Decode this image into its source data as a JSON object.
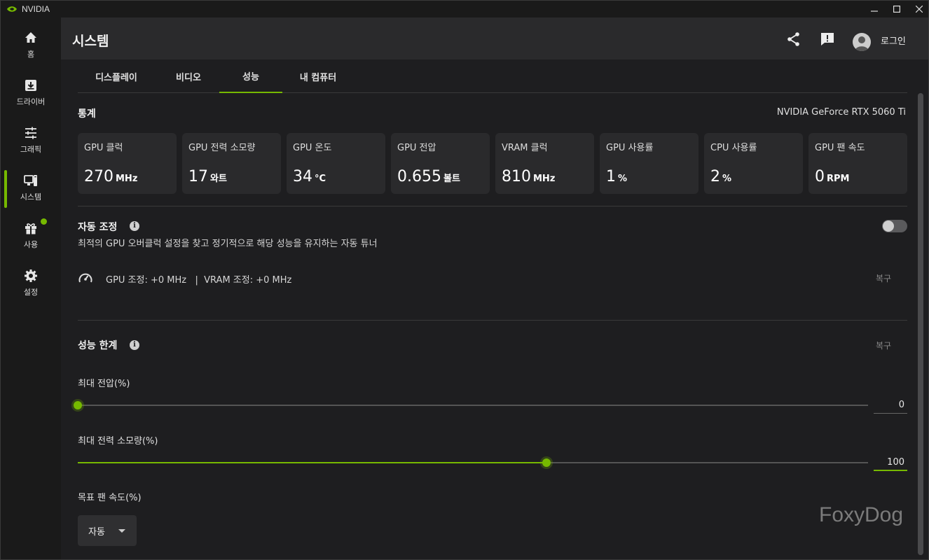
{
  "window": {
    "app_name": "NVIDIA"
  },
  "sidebar": {
    "items": [
      {
        "label": "홈",
        "icon": "home-icon"
      },
      {
        "label": "드라이버",
        "icon": "download-icon"
      },
      {
        "label": "그래픽",
        "icon": "sliders-icon"
      },
      {
        "label": "시스템",
        "icon": "system-icon",
        "active": true
      },
      {
        "label": "사용",
        "icon": "gift-icon",
        "notification": true
      },
      {
        "label": "설정",
        "icon": "gear-icon"
      }
    ]
  },
  "header": {
    "title": "시스템",
    "login_label": "로그인"
  },
  "tabs": [
    {
      "label": "디스플레이"
    },
    {
      "label": "비디오"
    },
    {
      "label": "성능",
      "active": true
    },
    {
      "label": "내 컴퓨터"
    }
  ],
  "stats": {
    "title": "통계",
    "gpu_name": "NVIDIA GeForce RTX 5060 Ti",
    "cards": [
      {
        "label": "GPU 클럭",
        "value": "270",
        "unit": "MHz"
      },
      {
        "label": "GPU 전력 소모량",
        "value": "17",
        "unit": "와트"
      },
      {
        "label": "GPU 온도",
        "value": "34",
        "unit": "°C"
      },
      {
        "label": "GPU 전압",
        "value": "0.655",
        "unit": "볼트"
      },
      {
        "label": "VRAM 클럭",
        "value": "810",
        "unit": "MHz"
      },
      {
        "label": "GPU 사용률",
        "value": "1",
        "unit": "%"
      },
      {
        "label": "CPU 사용률",
        "value": "2",
        "unit": "%"
      },
      {
        "label": "GPU 팬 속도",
        "value": "0",
        "unit": "RPM"
      }
    ]
  },
  "auto_tune": {
    "title": "자동 조정",
    "description": "최적의 GPU 오버클럭 설정을 찾고 정기적으로 해당 성능을 유지하는 자동 튜너",
    "toggle_on": false,
    "adjustment_text": "GPU 조정: +0 MHz   |  VRAM 조정: +0 MHz",
    "reset_label": "복구"
  },
  "performance_limits": {
    "title": "성능 한계",
    "reset_label": "복구",
    "sliders": [
      {
        "label": "최대 전압(%)",
        "value": "0",
        "fraction": 0.0
      },
      {
        "label": "최대 전력 소모량(%)",
        "value": "100",
        "fraction": 0.593
      }
    ],
    "fan_speed": {
      "label": "목표 팬 속도(%)",
      "selected": "자동"
    }
  },
  "watermark": "FoxyDog",
  "colors": {
    "accent": "#76b900",
    "background": "#1e1e20",
    "card": "#2a2a2c"
  }
}
